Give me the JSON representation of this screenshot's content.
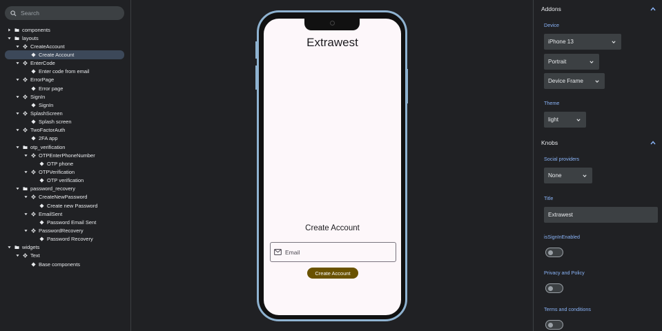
{
  "sidebar": {
    "search_placeholder": "Search",
    "tree": [
      {
        "label": "components",
        "depth": 0,
        "kind": "folder",
        "caret": "right"
      },
      {
        "label": "layouts",
        "depth": 0,
        "kind": "folder",
        "caret": "down"
      },
      {
        "label": "CreateAccount",
        "depth": 1,
        "kind": "component",
        "caret": "down"
      },
      {
        "label": "Create Account",
        "depth": 2,
        "kind": "story",
        "selected": true
      },
      {
        "label": "EnterCode",
        "depth": 1,
        "kind": "component",
        "caret": "down"
      },
      {
        "label": "Enter code from email",
        "depth": 2,
        "kind": "story"
      },
      {
        "label": "ErrorPage",
        "depth": 1,
        "kind": "component",
        "caret": "down"
      },
      {
        "label": "Error page",
        "depth": 2,
        "kind": "story"
      },
      {
        "label": "SignIn",
        "depth": 1,
        "kind": "component",
        "caret": "down"
      },
      {
        "label": "SignIn",
        "depth": 2,
        "kind": "story"
      },
      {
        "label": "SplashScreen",
        "depth": 1,
        "kind": "component",
        "caret": "down"
      },
      {
        "label": "Splash screen",
        "depth": 2,
        "kind": "story"
      },
      {
        "label": "TwoFactorAuth",
        "depth": 1,
        "kind": "component",
        "caret": "down"
      },
      {
        "label": "2FA app",
        "depth": 2,
        "kind": "story"
      },
      {
        "label": "otp_verification",
        "depth": 1,
        "kind": "folder",
        "caret": "down"
      },
      {
        "label": "OTPEnterPhoneNumber",
        "depth": 2,
        "kind": "component",
        "caret": "down"
      },
      {
        "label": "OTP phone",
        "depth": 3,
        "kind": "story"
      },
      {
        "label": "OTPVerification",
        "depth": 2,
        "kind": "component",
        "caret": "down"
      },
      {
        "label": "OTP verification",
        "depth": 3,
        "kind": "story"
      },
      {
        "label": "password_recovery",
        "depth": 1,
        "kind": "folder",
        "caret": "down"
      },
      {
        "label": "CreateNewPassword",
        "depth": 2,
        "kind": "component",
        "caret": "down"
      },
      {
        "label": "Create new Password",
        "depth": 3,
        "kind": "story"
      },
      {
        "label": "EmailSent",
        "depth": 2,
        "kind": "component",
        "caret": "down"
      },
      {
        "label": "Password Email Sent",
        "depth": 3,
        "kind": "story"
      },
      {
        "label": "PasswordRecovery",
        "depth": 2,
        "kind": "component",
        "caret": "down"
      },
      {
        "label": "Password Recovery",
        "depth": 3,
        "kind": "story"
      },
      {
        "label": "widgets",
        "depth": 0,
        "kind": "folder",
        "caret": "down"
      },
      {
        "label": "Text",
        "depth": 1,
        "kind": "component",
        "caret": "down"
      },
      {
        "label": "Base components",
        "depth": 2,
        "kind": "story"
      }
    ]
  },
  "preview": {
    "title": "Extrawest",
    "subtitle": "Create Account",
    "email_placeholder": "Email",
    "button_label": "Create Account"
  },
  "panel": {
    "addons_title": "Addons",
    "device_label": "Device",
    "device_value": "iPhone 13",
    "orientation_value": "Portrait",
    "frame_value": "Device Frame",
    "theme_label": "Theme",
    "theme_value": "light",
    "knobs_title": "Knobs",
    "social_label": "Social providers",
    "social_value": "None",
    "title_label": "Title",
    "title_value": "Extrawest",
    "signin_label": "isSignInEnabled",
    "signin_enabled": false,
    "privacy_label": "Privacy and Policy",
    "privacy_enabled": false,
    "terms_label": "Terms and conditions",
    "terms_enabled": false
  },
  "colors": {
    "accent": "#8ab4f8",
    "phone_frame": "#8fb3d1",
    "button": "#6a5300",
    "selected_row": "#3c4859"
  }
}
